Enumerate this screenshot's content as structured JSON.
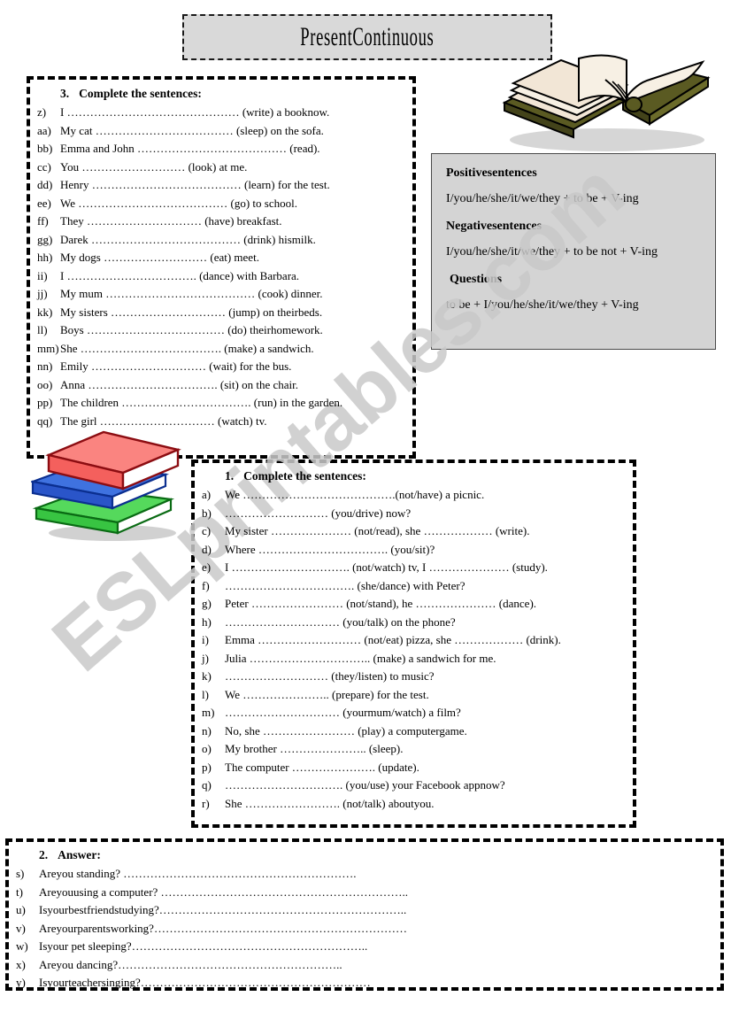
{
  "title": {
    "text": "PresentContinuous"
  },
  "watermark": {
    "text": "ESLprintables.com"
  },
  "grammar": {
    "positive_heading": "Positivesentences",
    "positive_formula": "I/you/he/she/it/we/they + to be + V-ing",
    "negative_heading": "Negativesentences",
    "negative_formula": "I/you/he/she/it/we/they + to be not + V-ing",
    "questions_heading": "Questions",
    "questions_formula": "to be + I/you/he/she/it/we/they + V-ing"
  },
  "exercise3": {
    "number": "3.",
    "instruction": "Complete the sentences:",
    "items": [
      {
        "label": "z)",
        "text": "I ……………………………………… (write) a booknow."
      },
      {
        "label": "aa)",
        "text": "My cat ……………………………… (sleep) on the sofa."
      },
      {
        "label": "bb)",
        "text": "Emma and John ………………………………… (read)."
      },
      {
        "label": "cc)",
        "text": "You ……………………… (look) at me."
      },
      {
        "label": "dd)",
        "text": "Henry ………………………………… (learn) for the test."
      },
      {
        "label": "ee)",
        "text": "We ………………………………… (go) to school."
      },
      {
        "label": "ff)",
        "text": "They ………………………… (have) breakfast."
      },
      {
        "label": "gg)",
        "text": "Darek ………………………………… (drink) hismilk."
      },
      {
        "label": "hh)",
        "text": "My dogs ……………………… (eat) meet."
      },
      {
        "label": "ii)",
        "text": "I ……………………………. (dance) with Barbara."
      },
      {
        "label": "jj)",
        "text": "My mum ………………………………… (cook) dinner."
      },
      {
        "label": "kk)",
        "text": "My sisters ………………………… (jump) on theirbeds."
      },
      {
        "label": "ll)",
        "text": "Boys ……………………………… (do) theirhomework."
      },
      {
        "label": "mm)",
        "text": "    She ………………………………. (make) a sandwich."
      },
      {
        "label": "nn)",
        "text": "Emily ………………………… (wait) for the bus."
      },
      {
        "label": "oo)",
        "text": "Anna ……………………………. (sit) on the chair."
      },
      {
        "label": "pp)",
        "text": "The children ……………………………. (run) in the garden."
      },
      {
        "label": "qq)",
        "text": "The girl ………………………… (watch) tv."
      }
    ]
  },
  "exercise1": {
    "number": "1.",
    "instruction": "Complete the sentences:",
    "items": [
      {
        "label": "a)",
        "text": "We ………………………………….(not/have) a picnic."
      },
      {
        "label": "b)",
        "text": "……………………… (you/drive) now?"
      },
      {
        "label": "c)",
        "text": "My sister ………………… (not/read), she ……………… (write)."
      },
      {
        "label": "d)",
        "text": "Where ……………………………. (you/sit)?"
      },
      {
        "label": "e)",
        "text": "I …………………………. (not/watch) tv, I ………………… (study)."
      },
      {
        "label": "f)",
        "text": "……………………………. (she/dance) with Peter?"
      },
      {
        "label": "g)",
        "text": "Peter …………………… (not/stand), he ………………… (dance)."
      },
      {
        "label": "h)",
        "text": "………………………… (you/talk) on the phone?"
      },
      {
        "label": "i)",
        "text": "Emma ……………………… (not/eat) pizza, she ……………… (drink)."
      },
      {
        "label": "j)",
        "text": "Julia ………………………….. (make) a sandwich for me."
      },
      {
        "label": "k)",
        "text": "……………………… (they/listen) to music?"
      },
      {
        "label": "l)",
        "text": "We ………………….. (prepare) for the test."
      },
      {
        "label": "m)",
        "text": "………………………… (yourmum/watch) a film?"
      },
      {
        "label": "n)",
        "text": "No, she …………………… (play) a computergame."
      },
      {
        "label": "o)",
        "text": "My brother ………………….. (sleep)."
      },
      {
        "label": "p)",
        "text": "The computer …………………. (update)."
      },
      {
        "label": "q)",
        "text": "…………………………. (you/use) your Facebook appnow?"
      },
      {
        "label": "r)",
        "text": "She ……………………. (not/talk) aboutyou."
      }
    ]
  },
  "exercise2": {
    "number": "2.",
    "instruction": "Answer:",
    "items": [
      {
        "label": "s)",
        "text": "Areyou standing? ……………………………………………………."
      },
      {
        "label": "t)",
        "text": "Areyouusing a computer? ……………………………………………………….."
      },
      {
        "label": "u)",
        "text": "Isyourbestfriendstudying?……………………………………………………….."
      },
      {
        "label": "v)",
        "text": "Areyourparentsworking?…………………………………………………………"
      },
      {
        "label": "w)",
        "text": "Isyour pet sleeping?…………………………………………………….."
      },
      {
        "label": "x)",
        "text": "Areyou dancing?………………………………………………….."
      },
      {
        "label": "y)",
        "text": "Isyourteachersinging?……………………………………………………"
      }
    ]
  },
  "clipart": {
    "open_book": "open-book-image",
    "book_stack": "stacked-books-image",
    "colors": {
      "book_cover": "#5a5a22",
      "book_page": "#f2e6d6",
      "stack_red": "#f4706e",
      "stack_blue": "#2a5fd4",
      "stack_green": "#4cd452"
    }
  }
}
